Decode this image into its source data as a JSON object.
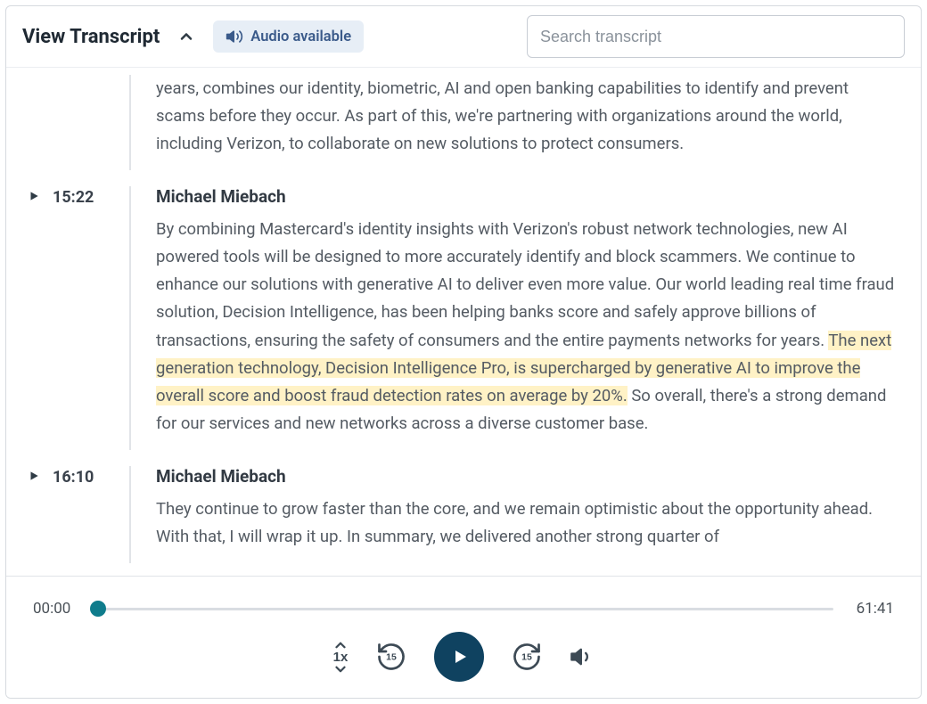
{
  "header": {
    "title": "View Transcript",
    "audio_badge": "Audio available",
    "search_placeholder": "Search transcript"
  },
  "transcript": {
    "seg0_text": "years, combines our identity, biometric, AI and open banking capabilities to identify and prevent scams before they occur. As part of this, we're partnering with organizations around the world, including Verizon, to collaborate on new solutions to protect consumers.",
    "seg1_time": "15:22",
    "seg1_speaker": "Michael Miebach",
    "seg1_pre": "By combining Mastercard's identity insights with Verizon's robust network technologies, new AI powered tools will be designed to more accurately identify and block scammers. We continue to enhance our solutions with generative AI to deliver even more value. Our world leading real time fraud solution, Decision Intelligence, has been helping banks score and safely approve billions of transactions, ensuring the safety of consumers and the entire payments networks for years. ",
    "seg1_hl": "The next generation technology, Decision Intelligence Pro, is supercharged by generative AI to improve the overall score and boost fraud detection rates on average by 20%.",
    "seg1_post": " So overall, there's a strong demand for our services and new networks across a diverse customer base.",
    "seg2_time": "16:10",
    "seg2_speaker": "Michael Miebach",
    "seg2_text": "They continue to grow faster than the core, and we remain optimistic about the opportunity ahead. With that, I will wrap it up. In summary, we delivered another strong quarter of"
  },
  "player": {
    "current": "00:00",
    "total": "61:41",
    "speed": "1x",
    "skip_back": "15",
    "skip_fwd": "15"
  }
}
